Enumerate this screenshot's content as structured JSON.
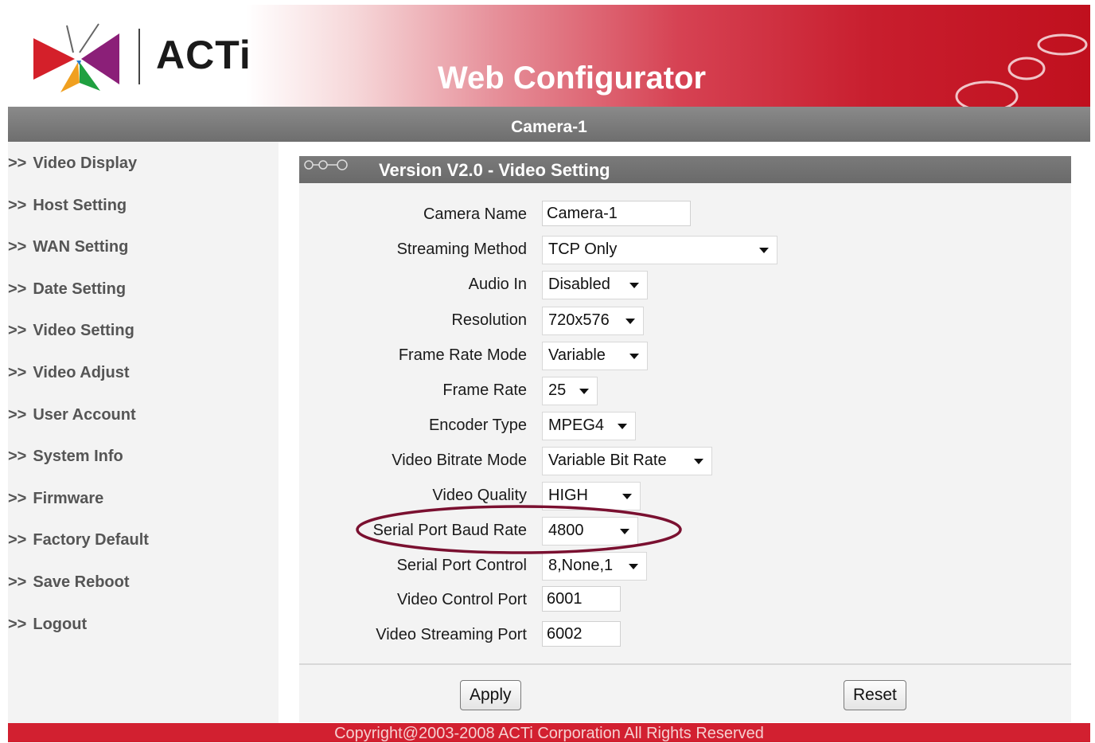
{
  "header": {
    "logo_text": "ACTi",
    "title": "Web Configurator",
    "camera_name": "Camera-1"
  },
  "sidebar": {
    "items": [
      {
        "arrow": ">>",
        "label": "Video Display"
      },
      {
        "arrow": ">>",
        "label": "Host Setting"
      },
      {
        "arrow": ">>",
        "label": "WAN Setting"
      },
      {
        "arrow": ">>",
        "label": "Date Setting"
      },
      {
        "arrow": ">>",
        "label": "Video Setting"
      },
      {
        "arrow": ">>",
        "label": "Video Adjust"
      },
      {
        "arrow": ">>",
        "label": "User Account"
      },
      {
        "arrow": ">>",
        "label": "System Info"
      },
      {
        "arrow": ">>",
        "label": "Firmware"
      },
      {
        "arrow": ">>",
        "label": "Factory Default"
      },
      {
        "arrow": ">>",
        "label": "Save Reboot"
      },
      {
        "arrow": ">>",
        "label": "Logout"
      }
    ]
  },
  "panel": {
    "title": "Version V2.0 - Video Setting",
    "fields": {
      "camera_name": {
        "label": "Camera Name",
        "value": "Camera-1"
      },
      "streaming_method": {
        "label": "Streaming Method",
        "value": "TCP Only"
      },
      "audio_in": {
        "label": "Audio In",
        "value": "Disabled"
      },
      "resolution": {
        "label": "Resolution",
        "value": "720x576"
      },
      "frame_rate_mode": {
        "label": "Frame Rate Mode",
        "value": "Variable"
      },
      "frame_rate": {
        "label": "Frame Rate",
        "value": "25"
      },
      "encoder_type": {
        "label": "Encoder Type",
        "value": "MPEG4"
      },
      "video_bitrate_mode": {
        "label": "Video Bitrate Mode",
        "value": "Variable Bit Rate"
      },
      "video_quality": {
        "label": "Video Quality",
        "value": "HIGH"
      },
      "serial_port_baud_rate": {
        "label": "Serial Port Baud Rate",
        "value": "4800"
      },
      "serial_port_control": {
        "label": "Serial Port Control",
        "value": "8,None,1"
      },
      "video_control_port": {
        "label": "Video Control Port",
        "value": "6001"
      },
      "video_streaming_port": {
        "label": "Video Streaming Port",
        "value": "6002"
      }
    },
    "apply_label": "Apply",
    "reset_label": "Reset"
  },
  "footer": {
    "copyright": "Copyright@2003-2008 ACTi Corporation All Rights Reserved"
  },
  "colors": {
    "brand_red": "#c8102e",
    "header_grey": "#6e6e6e",
    "highlight": "#7a1030"
  }
}
